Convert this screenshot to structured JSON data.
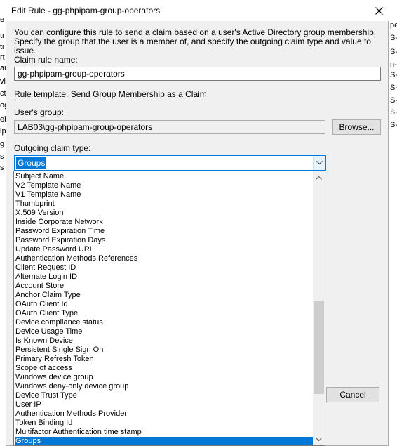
{
  "background": {
    "left_fragments": [
      "e",
      "tr",
      "ti",
      "rt",
      "ai",
      "vi",
      "ct",
      "og",
      "eb",
      "ip",
      "g",
      "s",
      "s"
    ],
    "right_fragments": [
      "pe",
      "S-",
      "S-",
      "n-",
      "S-",
      "S-",
      "S-",
      "S-",
      "S-"
    ]
  },
  "dialog": {
    "title": "Edit Rule - gg-phpipam-group-operators",
    "description": "You can configure this rule to send a claim based on a user's Active Directory group membership. Specify the group that the user is a member of, and specify the outgoing claim type and value to issue.",
    "claim_rule_name_label": "Claim rule name:",
    "claim_rule_name_value": "gg-phpipam-group-operators",
    "rule_template": "Rule template: Send Group Membership as a Claim",
    "users_group_label": "User's group:",
    "users_group_value": "LAB03\\gg-phpipam-group-operators",
    "browse_label": "Browse...",
    "outgoing_claim_type_label": "Outgoing claim type:",
    "outgoing_claim_type_value": "Groups",
    "cancel_label": "Cancel"
  },
  "dropdown": {
    "items": [
      "Subject Name",
      "V2 Template Name",
      "V1 Template Name",
      "Thumbprint",
      "X.509 Version",
      "Inside Corporate Network",
      "Password Expiration Time",
      "Password Expiration Days",
      "Update Password URL",
      "Authentication Methods References",
      "Client Request ID",
      "Alternate Login ID",
      "Account Store",
      "Anchor Claim Type",
      "OAuth Client Id",
      "OAuth Client Type",
      "Device compliance status",
      "Device Usage Time",
      "Is Known Device",
      "Persistent Single Sign On",
      "Primary Refresh Token",
      "Scope of access",
      "Windows device group",
      "Windows deny-only device group",
      "Device Trust Type",
      "User IP",
      "Authentication Methods Provider",
      "Token Binding Id",
      "Multifactor Authentication time stamp",
      "Groups"
    ],
    "selected": "Groups",
    "scroll_position": 0.75
  },
  "icons": {
    "close": "close-icon",
    "combo_arrow": "chevron-down-icon",
    "scroll_up": "chevron-up-icon",
    "scroll_down": "chevron-down-icon"
  },
  "colors": {
    "accent": "#0078d7",
    "dialog_bg": "#f0f0f0"
  }
}
